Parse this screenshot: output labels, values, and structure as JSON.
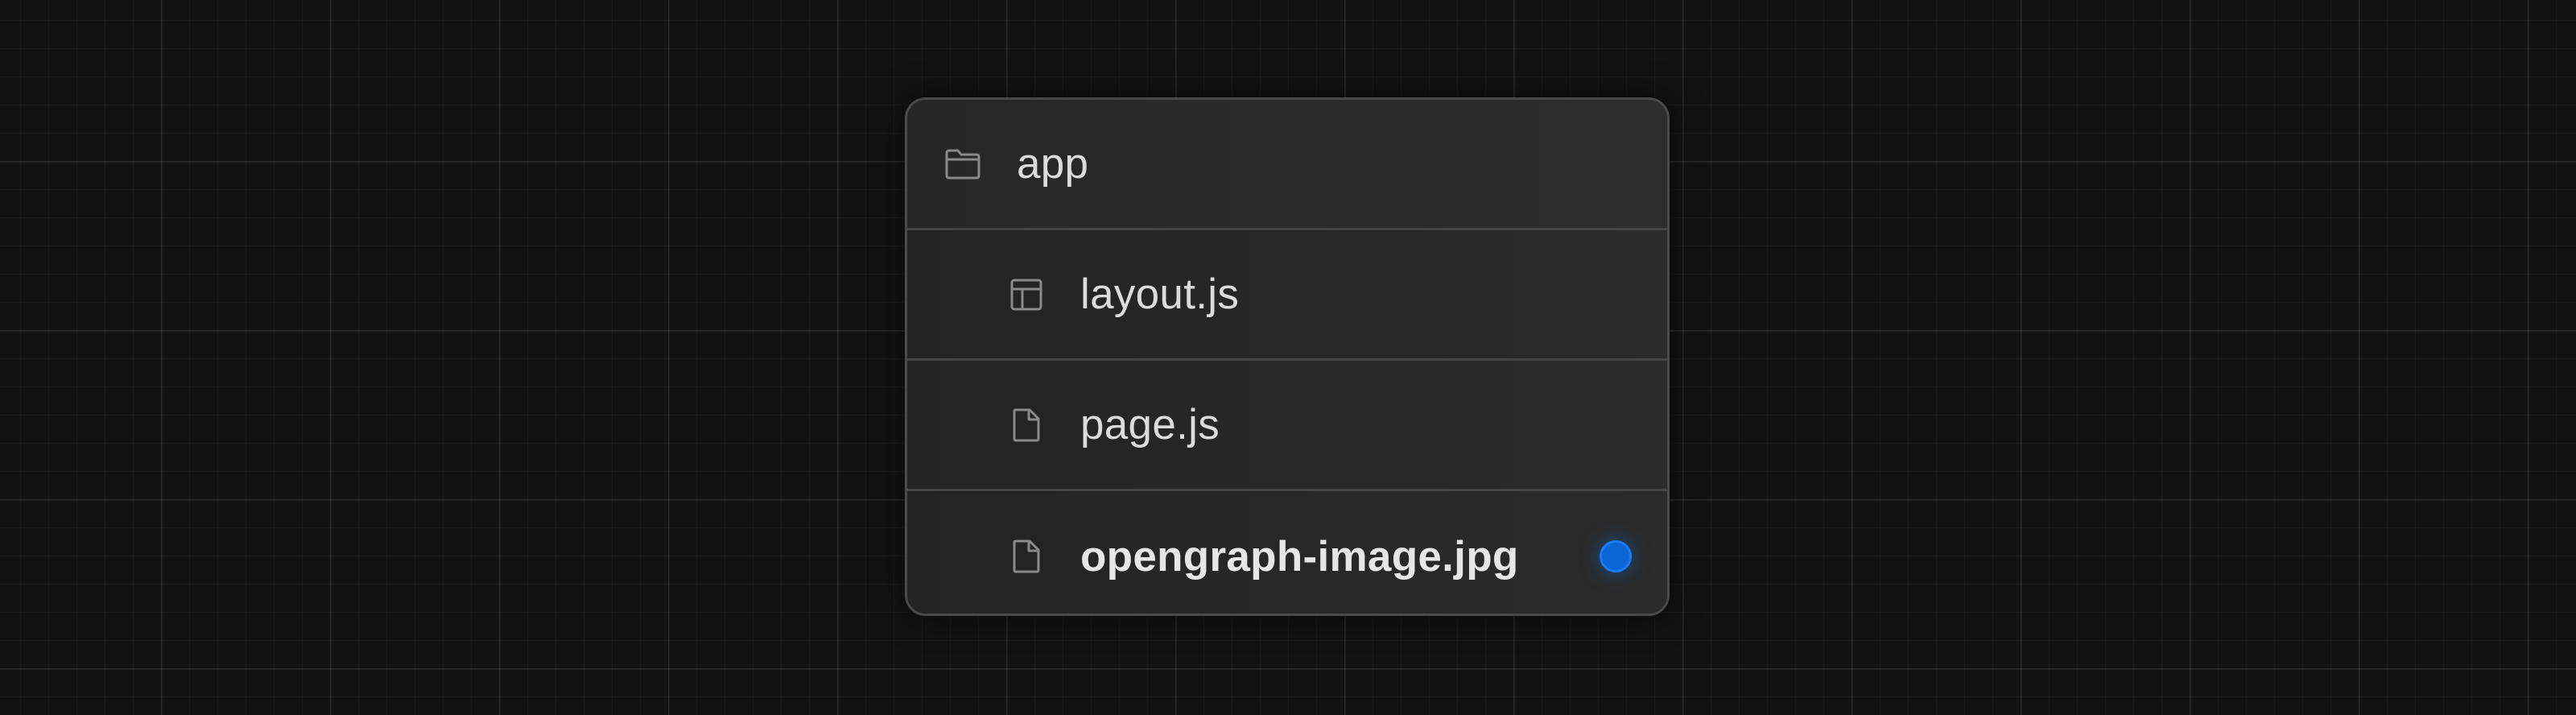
{
  "background": {
    "color": "#121212",
    "grid_line_color": "#2a2a2a"
  },
  "file_tree": {
    "items": [
      {
        "label": "app",
        "icon": "folder-icon",
        "level": 0,
        "bold": false
      },
      {
        "label": "layout.js",
        "icon": "layout-icon",
        "level": 1,
        "bold": false
      },
      {
        "label": "page.js",
        "icon": "file-icon",
        "level": 1,
        "bold": false
      },
      {
        "label": "opengraph-image.jpg",
        "icon": "file-icon",
        "level": 1,
        "bold": true,
        "highlighted": true
      }
    ],
    "highlight_color": "#0a66d6"
  }
}
